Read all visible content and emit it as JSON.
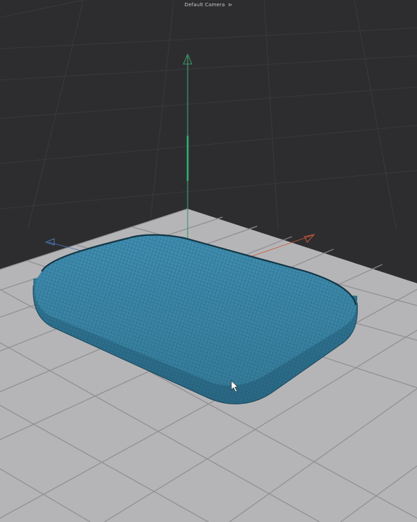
{
  "viewport": {
    "camera_label": "Default Camera",
    "camera_menu_icon": "dropdown-arrow-icon",
    "colors": {
      "background": "#2d2d30",
      "ground_plane": "#b5b5b7",
      "mesh": "#3b86a6",
      "y_axis": "#3f9a6a",
      "x_axis": "#c85a3a",
      "z_axis": "#4a7ab8"
    }
  }
}
